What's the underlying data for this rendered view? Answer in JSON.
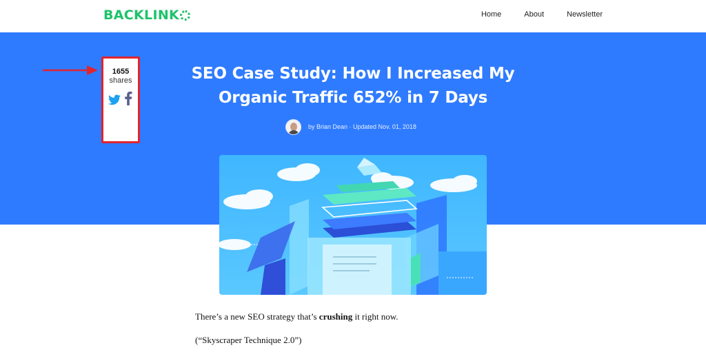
{
  "header": {
    "logo_text": "BACKLINK",
    "nav": [
      {
        "label": "Home"
      },
      {
        "label": "About"
      },
      {
        "label": "Newsletter"
      }
    ]
  },
  "colors": {
    "brand_green": "#1ec26a",
    "hero_blue": "#2f7bff",
    "highlight_red": "#e0242e",
    "twitter_blue": "#1da1f2",
    "facebook_indigo": "#5a5f8d"
  },
  "share": {
    "count": "1655",
    "label": "shares",
    "icons": [
      "twitter-icon",
      "facebook-icon"
    ]
  },
  "article": {
    "title": "SEO Case Study: How I Increased My Organic Traffic 652% in 7 Days",
    "byline": "by Brian Dean · Updated Nov. 01, 2018",
    "para1_before": "There’s a new SEO strategy that’s ",
    "para1_bold": "crushing",
    "para1_after": " it right now.",
    "para2": "(“Skyscraper Technique 2.0”)"
  }
}
